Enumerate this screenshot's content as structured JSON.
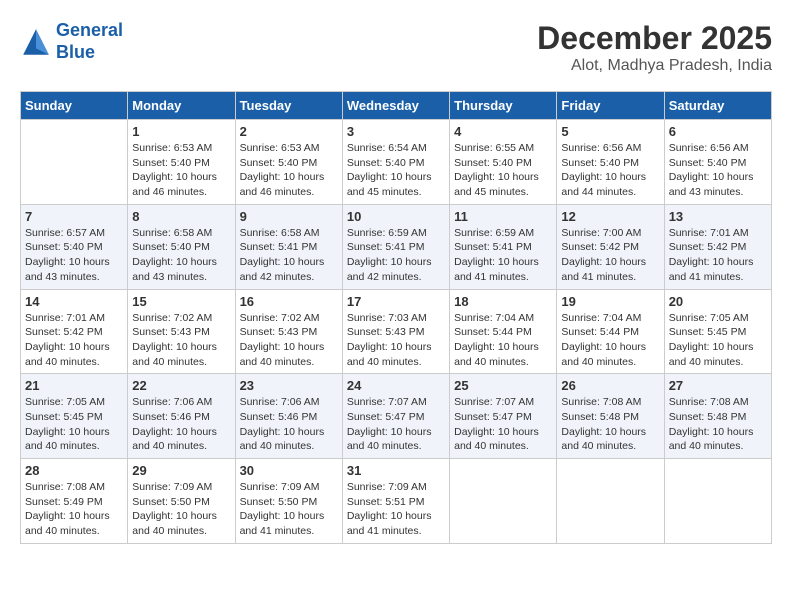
{
  "header": {
    "logo_line1": "General",
    "logo_line2": "Blue",
    "month": "December 2025",
    "location": "Alot, Madhya Pradesh, India"
  },
  "days_of_week": [
    "Sunday",
    "Monday",
    "Tuesday",
    "Wednesday",
    "Thursday",
    "Friday",
    "Saturday"
  ],
  "weeks": [
    [
      {
        "day": "",
        "info": ""
      },
      {
        "day": "1",
        "info": "Sunrise: 6:53 AM\nSunset: 5:40 PM\nDaylight: 10 hours\nand 46 minutes."
      },
      {
        "day": "2",
        "info": "Sunrise: 6:53 AM\nSunset: 5:40 PM\nDaylight: 10 hours\nand 46 minutes."
      },
      {
        "day": "3",
        "info": "Sunrise: 6:54 AM\nSunset: 5:40 PM\nDaylight: 10 hours\nand 45 minutes."
      },
      {
        "day": "4",
        "info": "Sunrise: 6:55 AM\nSunset: 5:40 PM\nDaylight: 10 hours\nand 45 minutes."
      },
      {
        "day": "5",
        "info": "Sunrise: 6:56 AM\nSunset: 5:40 PM\nDaylight: 10 hours\nand 44 minutes."
      },
      {
        "day": "6",
        "info": "Sunrise: 6:56 AM\nSunset: 5:40 PM\nDaylight: 10 hours\nand 43 minutes."
      }
    ],
    [
      {
        "day": "7",
        "info": "Sunrise: 6:57 AM\nSunset: 5:40 PM\nDaylight: 10 hours\nand 43 minutes."
      },
      {
        "day": "8",
        "info": "Sunrise: 6:58 AM\nSunset: 5:40 PM\nDaylight: 10 hours\nand 43 minutes."
      },
      {
        "day": "9",
        "info": "Sunrise: 6:58 AM\nSunset: 5:41 PM\nDaylight: 10 hours\nand 42 minutes."
      },
      {
        "day": "10",
        "info": "Sunrise: 6:59 AM\nSunset: 5:41 PM\nDaylight: 10 hours\nand 42 minutes."
      },
      {
        "day": "11",
        "info": "Sunrise: 6:59 AM\nSunset: 5:41 PM\nDaylight: 10 hours\nand 41 minutes."
      },
      {
        "day": "12",
        "info": "Sunrise: 7:00 AM\nSunset: 5:42 PM\nDaylight: 10 hours\nand 41 minutes."
      },
      {
        "day": "13",
        "info": "Sunrise: 7:01 AM\nSunset: 5:42 PM\nDaylight: 10 hours\nand 41 minutes."
      }
    ],
    [
      {
        "day": "14",
        "info": "Sunrise: 7:01 AM\nSunset: 5:42 PM\nDaylight: 10 hours\nand 40 minutes."
      },
      {
        "day": "15",
        "info": "Sunrise: 7:02 AM\nSunset: 5:43 PM\nDaylight: 10 hours\nand 40 minutes."
      },
      {
        "day": "16",
        "info": "Sunrise: 7:02 AM\nSunset: 5:43 PM\nDaylight: 10 hours\nand 40 minutes."
      },
      {
        "day": "17",
        "info": "Sunrise: 7:03 AM\nSunset: 5:43 PM\nDaylight: 10 hours\nand 40 minutes."
      },
      {
        "day": "18",
        "info": "Sunrise: 7:04 AM\nSunset: 5:44 PM\nDaylight: 10 hours\nand 40 minutes."
      },
      {
        "day": "19",
        "info": "Sunrise: 7:04 AM\nSunset: 5:44 PM\nDaylight: 10 hours\nand 40 minutes."
      },
      {
        "day": "20",
        "info": "Sunrise: 7:05 AM\nSunset: 5:45 PM\nDaylight: 10 hours\nand 40 minutes."
      }
    ],
    [
      {
        "day": "21",
        "info": "Sunrise: 7:05 AM\nSunset: 5:45 PM\nDaylight: 10 hours\nand 40 minutes."
      },
      {
        "day": "22",
        "info": "Sunrise: 7:06 AM\nSunset: 5:46 PM\nDaylight: 10 hours\nand 40 minutes."
      },
      {
        "day": "23",
        "info": "Sunrise: 7:06 AM\nSunset: 5:46 PM\nDaylight: 10 hours\nand 40 minutes."
      },
      {
        "day": "24",
        "info": "Sunrise: 7:07 AM\nSunset: 5:47 PM\nDaylight: 10 hours\nand 40 minutes."
      },
      {
        "day": "25",
        "info": "Sunrise: 7:07 AM\nSunset: 5:47 PM\nDaylight: 10 hours\nand 40 minutes."
      },
      {
        "day": "26",
        "info": "Sunrise: 7:08 AM\nSunset: 5:48 PM\nDaylight: 10 hours\nand 40 minutes."
      },
      {
        "day": "27",
        "info": "Sunrise: 7:08 AM\nSunset: 5:48 PM\nDaylight: 10 hours\nand 40 minutes."
      }
    ],
    [
      {
        "day": "28",
        "info": "Sunrise: 7:08 AM\nSunset: 5:49 PM\nDaylight: 10 hours\nand 40 minutes."
      },
      {
        "day": "29",
        "info": "Sunrise: 7:09 AM\nSunset: 5:50 PM\nDaylight: 10 hours\nand 40 minutes."
      },
      {
        "day": "30",
        "info": "Sunrise: 7:09 AM\nSunset: 5:50 PM\nDaylight: 10 hours\nand 41 minutes."
      },
      {
        "day": "31",
        "info": "Sunrise: 7:09 AM\nSunset: 5:51 PM\nDaylight: 10 hours\nand 41 minutes."
      },
      {
        "day": "",
        "info": ""
      },
      {
        "day": "",
        "info": ""
      },
      {
        "day": "",
        "info": ""
      }
    ]
  ]
}
